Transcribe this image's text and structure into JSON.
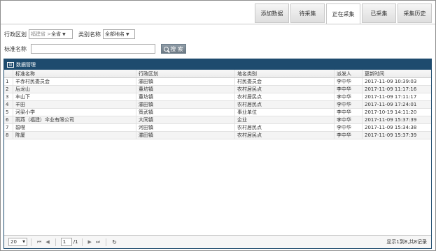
{
  "tabs": [
    {
      "label": "添加数据",
      "active": false
    },
    {
      "label": "待采集",
      "active": false
    },
    {
      "label": "正在采集",
      "active": true
    },
    {
      "label": "已采集",
      "active": false
    },
    {
      "label": "采集历史",
      "active": false
    }
  ],
  "filters": {
    "region_label": "行政区划",
    "region_province": "福建省 >",
    "region_value": "全省",
    "category_label": "类别名称",
    "category_value": "全部地名",
    "name_label": "标准名称",
    "name_value": "",
    "search_label": "搜 索"
  },
  "panel": {
    "title": "数据管理",
    "icon_text": "▤"
  },
  "table": {
    "headers": [
      "",
      "标准名称",
      "行政区划",
      "地名类别",
      "派发人",
      "更新时间"
    ],
    "rows": [
      [
        "1",
        "羊赤村民委员会",
        "灞田镇",
        "村民委员会",
        "李中华",
        "2017-11-09 10:39:03"
      ],
      [
        "2",
        "后龙山",
        "董坊镇",
        "农村居民点",
        "李中华",
        "2017-11-09 11:17:16"
      ],
      [
        "3",
        "丰山下",
        "董坊镇",
        "农村居民点",
        "李中华",
        "2017-11-09 17:11:17"
      ],
      [
        "4",
        "羊田",
        "灞田镇",
        "农村居民点",
        "李中华",
        "2017-11-09 17:24:01"
      ],
      [
        "5",
        "河梁小学",
        "策武镇",
        "事业单位",
        "李中华",
        "2017-10-19 14:11:20"
      ],
      [
        "6",
        "雨燕（福建）伞业有限公司",
        "大同镇",
        "企业",
        "李中华",
        "2017-11-09 15:37:39"
      ],
      [
        "7",
        "碧嚖",
        "河田镇",
        "农村居民点",
        "李中华",
        "2017-11-09 15:34:38"
      ],
      [
        "8",
        "陈厦",
        "灞田镇",
        "农村居民点",
        "李中华",
        "2017-11-09 15:37:39"
      ]
    ]
  },
  "pager": {
    "page_size": "20",
    "first": "⏮",
    "prev": "◀",
    "page_value": "1",
    "total_pages": "/1",
    "next": "▶",
    "last": "⏭",
    "refresh": "↻",
    "info": "显示1到8,共8记录"
  }
}
